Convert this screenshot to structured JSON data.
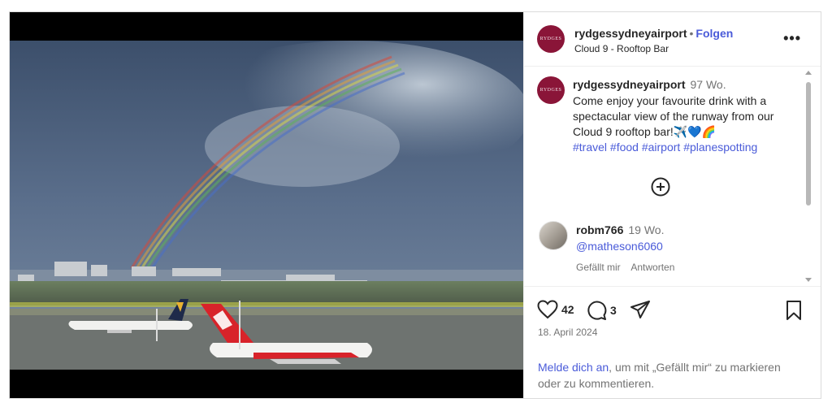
{
  "post": {
    "account": {
      "username": "rydgessydneyairport",
      "avatar_text": "RYDGES",
      "follow_label": "Folgen",
      "separator": "•",
      "location": "Cloud 9 - Rooftop Bar"
    },
    "more_label": "•••",
    "caption": {
      "username": "rydgessydneyairport",
      "time": "97 Wo.",
      "text": "Come enjoy your favourite drink with a spectacular view of the runway from our Cloud 9 rooftop bar!✈️💙🌈",
      "hashtags": "#travel #food #airport #planespotting"
    },
    "comment": {
      "username": "robm766",
      "time": "19 Wo.",
      "text": "@matheson6060",
      "like_label": "Gefällt mir",
      "reply_label": "Antworten"
    },
    "likes_count": "42",
    "comments_count": "3",
    "date": "18. April 2024",
    "login_prompt": {
      "link": "Melde dich an",
      "rest": ", um mit „Gefällt mir“ zu markieren oder zu kommentieren."
    }
  }
}
